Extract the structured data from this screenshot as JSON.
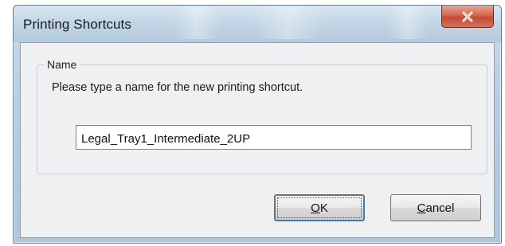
{
  "window": {
    "title": "Printing Shortcuts",
    "close_icon": "close-icon"
  },
  "group": {
    "label": "Name",
    "prompt": "Please type a name for the new printing shortcut."
  },
  "name_field": {
    "value": "Legal_Tray1_Intermediate_2UP"
  },
  "buttons": {
    "ok": {
      "mnemonic": "O",
      "rest": "K"
    },
    "cancel": {
      "mnemonic": "C",
      "rest": "ancel"
    }
  },
  "colors": {
    "frame": "#b8cde0",
    "client": "#eef0f2",
    "close_button": "#c44b34"
  }
}
